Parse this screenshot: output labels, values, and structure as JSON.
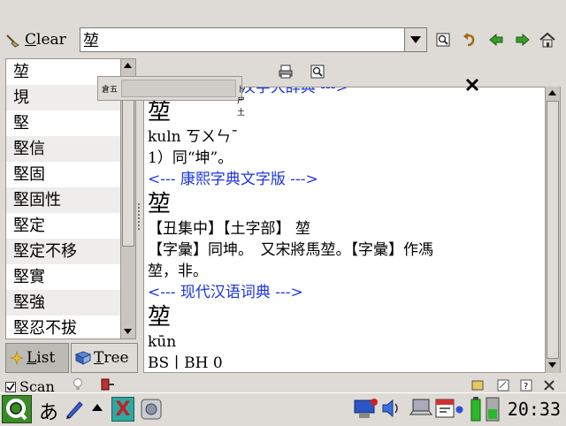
{
  "toolbar": {
    "clear_label_u": "C",
    "clear_label_rest": "lear",
    "search_value": "堃"
  },
  "word_list": [
    "堃",
    "垷",
    "堅",
    "堅信",
    "堅固",
    "堅固性",
    "堅定",
    "堅定不移",
    "堅實",
    "堅強",
    "堅忍不拔"
  ],
  "tabs": {
    "list_u": "L",
    "list_rest": "ist",
    "tree_u": "T",
    "tree_rest": "ree"
  },
  "ime": {
    "label1": "倉五",
    "label2": "卜尸土"
  },
  "content": {
    "hdr1": "<--- 国际标准汉字大辞典 --->",
    "word1": "堃",
    "pron1": "kuln   ㄎㄨㄣ¯",
    "def1": "1）同“坤”。",
    "hdr2": "<--- 康熙字典文字版 --->",
    "word2": "堃",
    "kx1": "【丑集中】【土字部】 堃",
    "kx2": "【字彙】同坤。　又宋將馬堃。【字彙】作馮",
    "kx3": "堃，非。",
    "hdr3": "<--- 现代汉语词典 --->",
    "word3": "堃",
    "pron3": "kūn",
    "code3": "BS丨BH 0"
  },
  "status": {
    "scan_label": "Scan"
  },
  "taskbar": {
    "ime_char": "あ",
    "clock": "20:33",
    "x_label": "X"
  },
  "colors": {
    "header_blue": "#1c34e2",
    "panel_bg": "#dedbd6"
  }
}
